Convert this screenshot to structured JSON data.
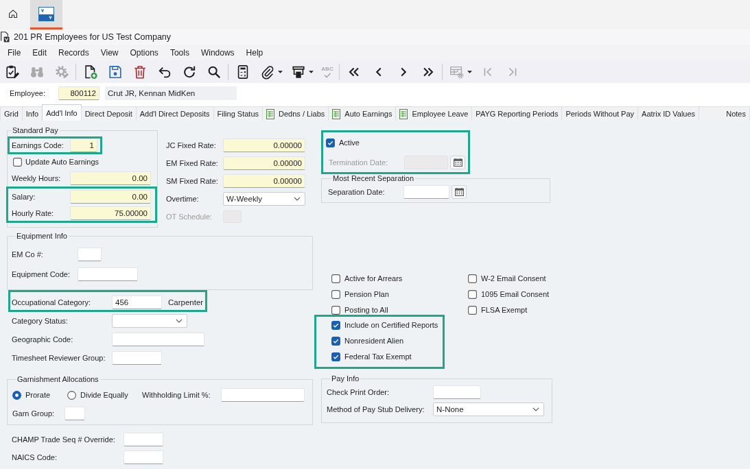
{
  "app_tabs": [
    {
      "kind": "home",
      "selected": false
    },
    {
      "kind": "window",
      "selected": true
    }
  ],
  "window": {
    "title": "201 PR Employees for US Test Company"
  },
  "menu": [
    "File",
    "Edit",
    "Records",
    "View",
    "Options",
    "Tools",
    "Windows",
    "Help"
  ],
  "toolbar_groups": [
    {
      "buttons": [
        {
          "kind": "clipboard-check",
          "disabled": false,
          "dropdown": false
        },
        {
          "kind": "binoculars",
          "disabled": true,
          "dropdown": false
        },
        {
          "kind": "gear",
          "disabled": true,
          "dropdown": false
        }
      ]
    },
    {
      "buttons": [
        {
          "kind": "new-document",
          "disabled": false,
          "dropdown": false
        },
        {
          "kind": "save",
          "disabled": false,
          "dropdown": false
        },
        {
          "kind": "trash",
          "disabled": false,
          "dropdown": false
        },
        {
          "kind": "undo",
          "disabled": false,
          "dropdown": false
        },
        {
          "kind": "redo",
          "disabled": false,
          "dropdown": false
        },
        {
          "kind": "search",
          "disabled": false,
          "dropdown": false
        }
      ]
    },
    {
      "buttons": [
        {
          "kind": "calculator",
          "disabled": false,
          "dropdown": false
        },
        {
          "kind": "paperclip",
          "disabled": false,
          "dropdown": true
        },
        {
          "kind": "printer",
          "disabled": false,
          "dropdown": true
        },
        {
          "kind": "spell-check",
          "caption": "ABC",
          "disabled": true,
          "dropdown": false
        }
      ]
    },
    {
      "buttons": [
        {
          "kind": "double-chevron-left",
          "disabled": false,
          "dropdown": false
        },
        {
          "kind": "chevron-left",
          "disabled": false,
          "dropdown": false
        },
        {
          "kind": "chevron-right",
          "disabled": false,
          "dropdown": false
        },
        {
          "kind": "double-chevron-right",
          "disabled": false,
          "dropdown": false
        }
      ]
    },
    {
      "buttons": [
        {
          "kind": "table-gear",
          "disabled": true,
          "dropdown": true
        },
        {
          "kind": "bar-chevron-left",
          "disabled": true,
          "dropdown": false
        },
        {
          "kind": "chevron-bar-right",
          "disabled": true,
          "dropdown": false
        }
      ]
    }
  ],
  "employee": {
    "label": "Employee:",
    "value": "800112",
    "required": true,
    "name": "Crut JR, Kennan MidKen"
  },
  "tabs": [
    {
      "label": "Grid",
      "selected": false,
      "icon": false
    },
    {
      "label": "Info",
      "selected": false,
      "icon": false
    },
    {
      "label": "Add'l Info",
      "selected": true,
      "icon": false
    },
    {
      "label": "Direct Deposit",
      "selected": false,
      "icon": false
    },
    {
      "label": "Add'l Direct Deposits",
      "selected": false,
      "icon": false
    },
    {
      "label": "Filing Status",
      "selected": false,
      "icon": false
    },
    {
      "label": "Dedns / Liabs",
      "selected": false,
      "icon": true
    },
    {
      "label": "Auto Earnings",
      "selected": false,
      "icon": true
    },
    {
      "label": "Employee Leave",
      "selected": false,
      "icon": true
    },
    {
      "label": "PAYG Reporting Periods",
      "selected": false,
      "icon": false
    },
    {
      "label": "Periods Without Pay",
      "selected": false,
      "icon": false
    },
    {
      "label": "Aatrix ID Values",
      "selected": false,
      "icon": false
    },
    {
      "label": "Notes",
      "selected": false,
      "icon": false
    }
  ],
  "standard_pay": {
    "legend": "Standard Pay",
    "blocks": [
      {
        "highlighted": true,
        "items": [
          {
            "kind": "field",
            "label": "Earnings Code:",
            "value": "1",
            "required": true
          }
        ]
      },
      {
        "highlighted": false,
        "items": [
          {
            "kind": "checkbox",
            "label": "Update Auto Earnings",
            "checked": false
          },
          {
            "kind": "field",
            "label": "Weekly Hours:",
            "value": "0.00",
            "required": true
          }
        ]
      },
      {
        "highlighted": true,
        "items": [
          {
            "kind": "field",
            "label": "Salary:",
            "value": "0.00",
            "required": true
          },
          {
            "kind": "field",
            "label": "Hourly Rate:",
            "value": "75.00000",
            "required": true
          }
        ]
      }
    ]
  },
  "rates": [
    {
      "kind": "field",
      "label": "JC Fixed Rate:",
      "value": "0.00000",
      "required": true,
      "disabled": false
    },
    {
      "kind": "field",
      "label": "EM Fixed Rate:",
      "value": "0.00000",
      "required": true,
      "disabled": false
    },
    {
      "kind": "field",
      "label": "SM Fixed Rate:",
      "value": "0.00000",
      "required": true,
      "disabled": false
    },
    {
      "kind": "select",
      "label": "Overtime:",
      "value": "W-Weekly",
      "required": false,
      "disabled": false
    },
    {
      "kind": "field",
      "label": "OT Schedule:",
      "required": false,
      "disabled": true
    }
  ],
  "status": {
    "highlighted": true,
    "items": [
      {
        "kind": "checkbox",
        "label": "Active",
        "checked": true,
        "disabled": false
      },
      {
        "kind": "date",
        "label": "Termination Date:",
        "disabled": true
      }
    ]
  },
  "separation": {
    "legend": "Most Recent Separation",
    "items": [
      {
        "kind": "date",
        "label": "Separation Date:"
      }
    ]
  },
  "equipment_info": {
    "legend": "Equipment Info",
    "items": [
      {
        "kind": "field",
        "label": "EM Co #:"
      },
      {
        "kind": "field",
        "label": "Equipment Code:"
      }
    ]
  },
  "flag_columns": [
    {
      "blocks": [
        {
          "highlighted": false,
          "items": [
            {
              "label": "Active for Arrears",
              "checked": false
            },
            {
              "label": "Pension Plan",
              "checked": false
            },
            {
              "label": "Posting to All",
              "checked": false
            }
          ]
        },
        {
          "highlighted": true,
          "items": [
            {
              "label": "Include on Certified Reports",
              "checked": true
            },
            {
              "label": "Nonresident Alien",
              "checked": true
            },
            {
              "label": "Federal Tax Exempt",
              "checked": true
            }
          ]
        }
      ]
    },
    {
      "blocks": [
        {
          "highlighted": false,
          "items": [
            {
              "label": "W-2 Email Consent",
              "checked": false
            },
            {
              "label": "1095 Email Consent",
              "checked": false
            },
            {
              "label": "FLSA Exempt",
              "checked": false
            }
          ]
        }
      ]
    }
  ],
  "occupation": {
    "highlighted": true,
    "items": [
      {
        "kind": "field",
        "label": "Occupational Category:",
        "value": "456",
        "description": "Carpenter"
      }
    ]
  },
  "category_fields": [
    {
      "kind": "select",
      "label": "Category Status:"
    },
    {
      "kind": "field",
      "label": "Geographic Code:"
    },
    {
      "kind": "field",
      "label": "Timesheet Reviewer Group:"
    }
  ],
  "garnishment": {
    "legend": "Garnishment Allocations",
    "options": [
      {
        "label": "Prorate",
        "selected": true
      },
      {
        "label": "Divide Equally",
        "selected": false
      }
    ],
    "limit": {
      "kind": "field",
      "label": "Withholding Limit %:"
    },
    "group": {
      "kind": "field",
      "label": "Garn Group:"
    }
  },
  "pay_info": {
    "legend": "Pay Info",
    "items": [
      {
        "kind": "field",
        "label": "Check Print Order:"
      },
      {
        "kind": "select",
        "label": "Method of Pay Stub Delivery:",
        "value": "N-None"
      }
    ]
  },
  "bottom_fields": [
    {
      "kind": "field",
      "label": "CHAMP Trade Seq # Override:"
    },
    {
      "kind": "field",
      "label": "NAICS Code:"
    }
  ]
}
